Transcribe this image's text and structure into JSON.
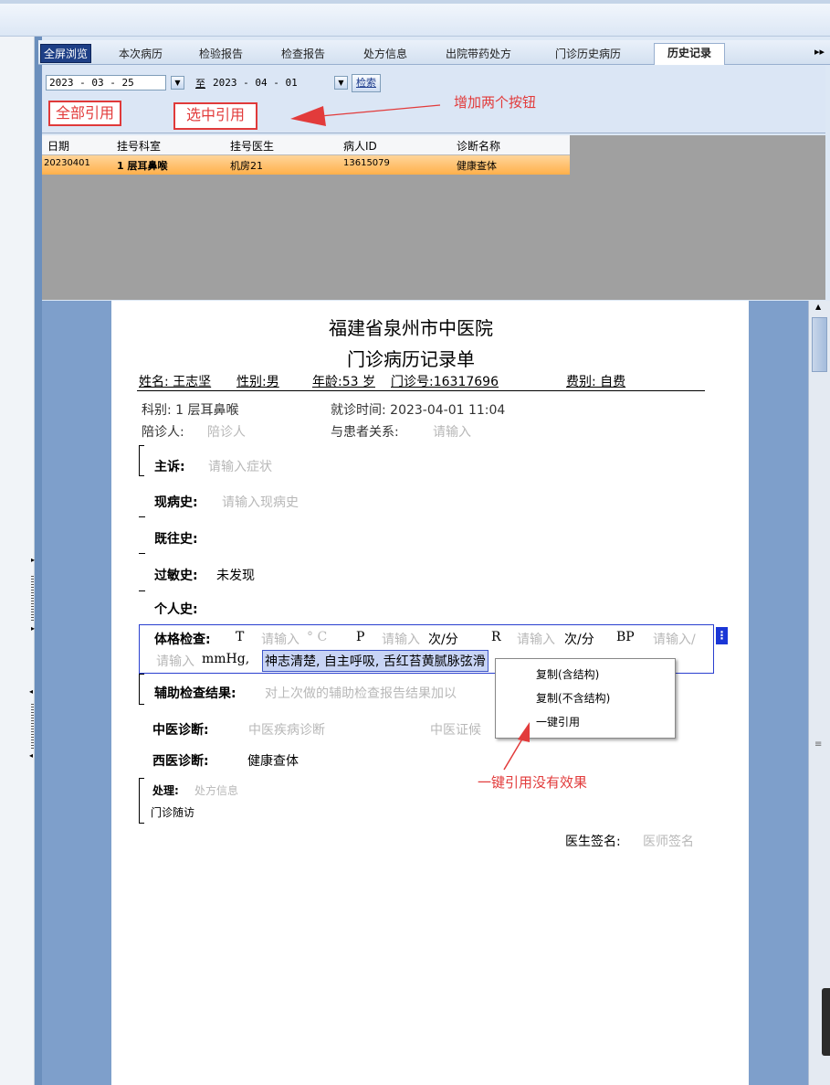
{
  "tabs": [
    "全屏浏览",
    "本次病历",
    "检验报告",
    "检查报告",
    "处方信息",
    "出院带药处方",
    "门诊历史病历",
    "历史记录"
  ],
  "tab_more": "▸▸",
  "filter": {
    "date_from": "2023 - 03 - 25",
    "to_label": "至",
    "date_to": "2023 - 04 - 01",
    "search": "检索"
  },
  "annotations": {
    "quote_all": "全部引用",
    "quote_selected": "选中引用",
    "add_two_buttons": "增加两个按钮",
    "no_effect": "一键引用没有效果"
  },
  "grid": {
    "columns": [
      "日期",
      "挂号科室",
      "挂号医生",
      "病人ID",
      "诊断名称"
    ],
    "rows": [
      [
        "20230401",
        "1 层耳鼻喉",
        "机房21",
        "13615079",
        "健康查体"
      ]
    ]
  },
  "doc": {
    "hospital": "福建省泉州市中医院",
    "form_title": "门诊病历记录单",
    "name": "姓名: 王志坚",
    "sex": "性别:男",
    "age": "年龄:53 岁",
    "clinic_no": "门诊号:16317696",
    "fee": "费别: 自费",
    "dept": "科别: 1 层耳鼻喉",
    "visit_time": "就诊时间: 2023-04-01 11:04",
    "companion_label": "陪诊人: ",
    "companion_ph": "陪诊人",
    "relation_label": "与患者关系: ",
    "relation_ph": "请输入",
    "complaint_label": "主诉: ",
    "complaint_ph": "请输入症状",
    "present_label": "现病史: ",
    "present_ph": "请输入现病史",
    "past_label": "既往史:",
    "allergy_label": "过敏史: ",
    "allergy_val": "未发现",
    "personal_label": "个人史:",
    "exam_label": "体格检查: ",
    "exam_T": "T",
    "exam_ph1": "请输入",
    "exam_deg": "° C",
    "exam_P": "P",
    "exam_ph2": "请输入",
    "exam_unit1": "次/分",
    "exam_R": "R",
    "exam_ph3": "请输入",
    "exam_unit2": "次/分",
    "exam_BP": "BP",
    "exam_ph4": "请输入/",
    "exam_ph5": "请输入",
    "exam_mmhg": "mmHg,",
    "exam_selected": "神志清楚, 自主呼吸, 舌红苔黄腻脉弦滑",
    "aux_label": "辅助检查结果: ",
    "aux_ph": "对上次做的辅助检查报告结果加以",
    "tcm_label": "中医诊断: ",
    "tcm_ph": "中医疾病诊断",
    "tcm_syndrome_ph": "中医证候",
    "western_label": "西医诊断: ",
    "western_val": "健康查体",
    "treat_label": "处理: ",
    "treat_ph": "处方信息",
    "followup": "门诊随访",
    "sign_label": "医生签名: ",
    "sign_ph": "医师签名"
  },
  "context_menu": [
    "复制(含结构)",
    "复制(不含结构)",
    "一键引用"
  ]
}
